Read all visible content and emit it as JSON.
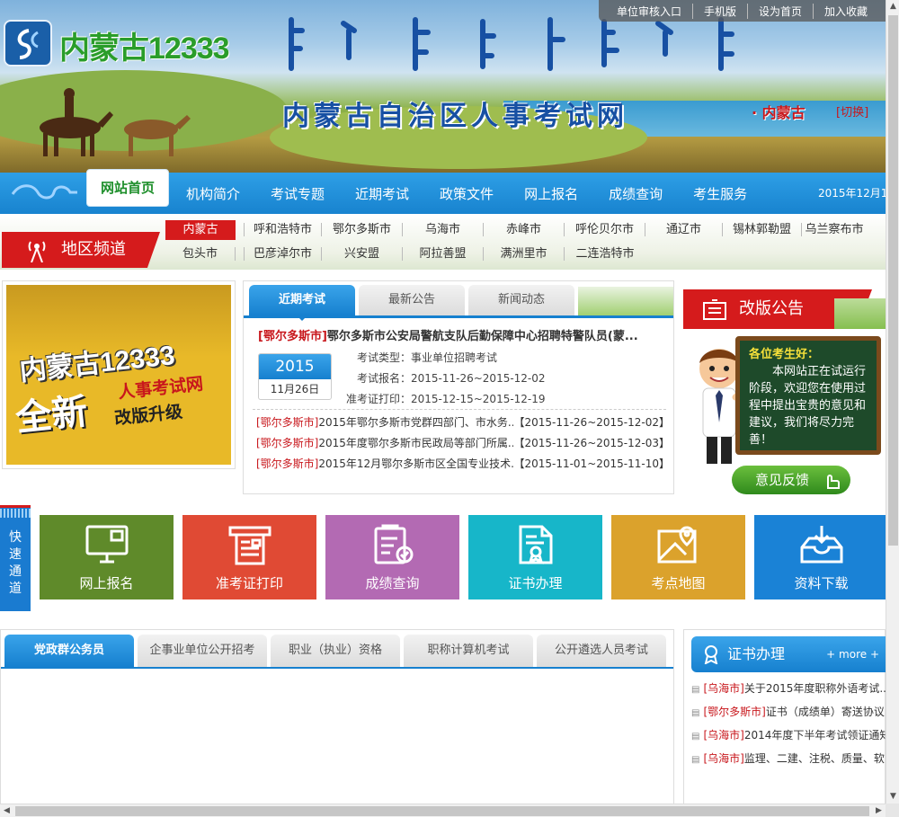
{
  "header": {
    "logo_text": "内蒙古12333",
    "site_title": "内蒙古自治区人事考试网",
    "region": "· 内蒙古",
    "switch": "[切换]",
    "top_links": [
      "单位审核入口",
      "手机版",
      "设为首页",
      "加入收藏"
    ]
  },
  "nav": {
    "home": "网站首页",
    "items": [
      "机构简介",
      "考试专题",
      "近期考试",
      "政策文件",
      "网上报名",
      "成绩查询",
      "考生服务"
    ],
    "date": "2015年12月1"
  },
  "region_channel": {
    "label": "地区频道",
    "row1": [
      "内蒙古",
      "呼和浩特市",
      "鄂尔多斯市",
      "乌海市",
      "赤峰市",
      "呼伦贝尔市",
      "通辽市",
      "锡林郭勒盟",
      "乌兰察布市"
    ],
    "row2": [
      "包头市",
      "巴彦淖尔市",
      "兴安盟",
      "阿拉善盟",
      "满洲里市",
      "二连浩特市"
    ]
  },
  "banner": {
    "logo": "内蒙古12333",
    "big": "全新",
    "line1": "人事考试网",
    "line2": "改版升级"
  },
  "exams": {
    "tabs": [
      "近期考试",
      "最新公告",
      "新闻动态"
    ],
    "featured": {
      "tag": "[鄂尔多斯市]",
      "title": "鄂尔多斯市公安局警航支队后勤保障中心招聘特警队员(蒙...",
      "year": "2015",
      "date": "11月26日",
      "type_label": "考试类型：",
      "type_value": "事业单位招聘考试",
      "reg_label": "考试报名：",
      "reg_value": "2015-11-26~2015-12-02",
      "print_label": "准考证打印：",
      "print_value": "2015-12-15~2015-12-19"
    },
    "list": [
      {
        "tag": "[鄂尔多斯市]",
        "title": "2015年鄂尔多斯市党群四部门、市水务...",
        "range": "【2015-11-26~2015-12-02】"
      },
      {
        "tag": "[鄂尔多斯市]",
        "title": "2015年度鄂尔多斯市民政局等部门所属...",
        "range": "【2015-11-26~2015-12-03】"
      },
      {
        "tag": "[鄂尔多斯市]",
        "title": "2015年12月鄂尔多斯市区全国专业技术...",
        "range": "【2015-11-01~2015-11-10】"
      }
    ]
  },
  "notice": {
    "title": "改版公告",
    "greeting": "各位考生好：",
    "body": "本网站正在试运行阶段，欢迎您在使用过程中提出宝贵的意见和建议，我们将尽力完善！",
    "feedback": "意见反馈"
  },
  "quick": {
    "label": "快速通道",
    "tiles": [
      {
        "label": "网上报名",
        "color": "#5f8a2a",
        "icon": "computer-icon"
      },
      {
        "label": "准考证打印",
        "color": "#e04a34",
        "icon": "printer-icon"
      },
      {
        "label": "成绩查询",
        "color": "#b36ab3",
        "icon": "clipboard-icon"
      },
      {
        "label": "证书办理",
        "color": "#17b6c9",
        "icon": "certificate-icon"
      },
      {
        "label": "考点地图",
        "color": "#dba22c",
        "icon": "map-icon"
      },
      {
        "label": "资料下载",
        "color": "#1a82d6",
        "icon": "download-icon"
      }
    ]
  },
  "bottom_tabs": [
    "党政群公务员",
    "企事业单位公开招考",
    "职业（执业）资格",
    "职称计算机考试",
    "公开遴选人员考试"
  ],
  "cert": {
    "title": "证书办理",
    "more": "+ more +",
    "items": [
      {
        "tag": "[乌海市]",
        "title": "关于2015年度职称外语考试..."
      },
      {
        "tag": "[鄂尔多斯市]",
        "title": "证书（成绩单）寄送协议"
      },
      {
        "tag": "[乌海市]",
        "title": "2014年度下半年考试领证通知"
      },
      {
        "tag": "[乌海市]",
        "title": "监理、二建、注税、质量、软"
      }
    ]
  }
}
